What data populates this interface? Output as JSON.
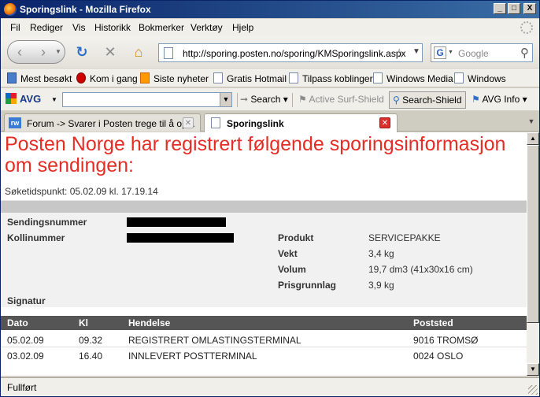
{
  "window": {
    "title": "Sporingslink - Mozilla Firefox",
    "controls": [
      "_",
      "□",
      "X"
    ]
  },
  "menu": [
    "Fil",
    "Rediger",
    "Vis",
    "Historikk",
    "Bokmerker",
    "Verktøy",
    "Hjelp"
  ],
  "nav": {
    "url": "http://sporing.posten.no/sporing/KMSporingslink.aspx",
    "search_placeholder": "Google",
    "search_engine_letter": "G"
  },
  "bookmarks": [
    "Mest besøkt",
    "Kom i gang",
    "Siste nyheter",
    "Gratis Hotmail",
    "Tilpass koblinger",
    "Windows Media",
    "Windows"
  ],
  "avg": {
    "logo": "AVG",
    "search": "Search",
    "surf_shield": "Active Surf-Shield",
    "search_shield": "Search-Shield",
    "info": "AVG Info"
  },
  "tabs": [
    {
      "label": "Forum -> Svarer i Posten trege til å op...",
      "icon": "fw",
      "active": false
    },
    {
      "label": "Sporingslink",
      "icon": "document",
      "active": true
    }
  ],
  "content": {
    "headline": "Posten Norge har registrert følgende sporingsinformasjon om sendingen:",
    "search_time": "Søketidspunkt: 05.02.09 kl. 17.19.14",
    "shipment": {
      "sendingsnummer_label": "Sendingsnummer",
      "kollinummer_label": "Kollinummer",
      "signatur_label": "Signatur",
      "produkt_label": "Produkt",
      "produkt_value": "SERVICEPAKKE",
      "vekt_label": "Vekt",
      "vekt_value": "3,4 kg",
      "volum_label": "Volum",
      "volum_value": "19,7 dm3 (41x30x16 cm)",
      "prisgrunnlag_label": "Prisgrunnlag",
      "prisgrunnlag_value": "3,9 kg"
    },
    "events": {
      "headers": [
        "Dato",
        "Kl",
        "Hendelse",
        "Poststed"
      ],
      "rows": [
        [
          "05.02.09",
          "09.32",
          "REGISTRERT OMLASTINGSTERMINAL",
          "9016 TROMSØ"
        ],
        [
          "03.02.09",
          "16.40",
          "INNLEVERT POSTTERMINAL",
          "0024 OSLO"
        ]
      ]
    }
  },
  "status": "Fullført",
  "colors": {
    "headline": "#e52d26",
    "table_header": "#555555",
    "title_bar": "#0a246a"
  }
}
